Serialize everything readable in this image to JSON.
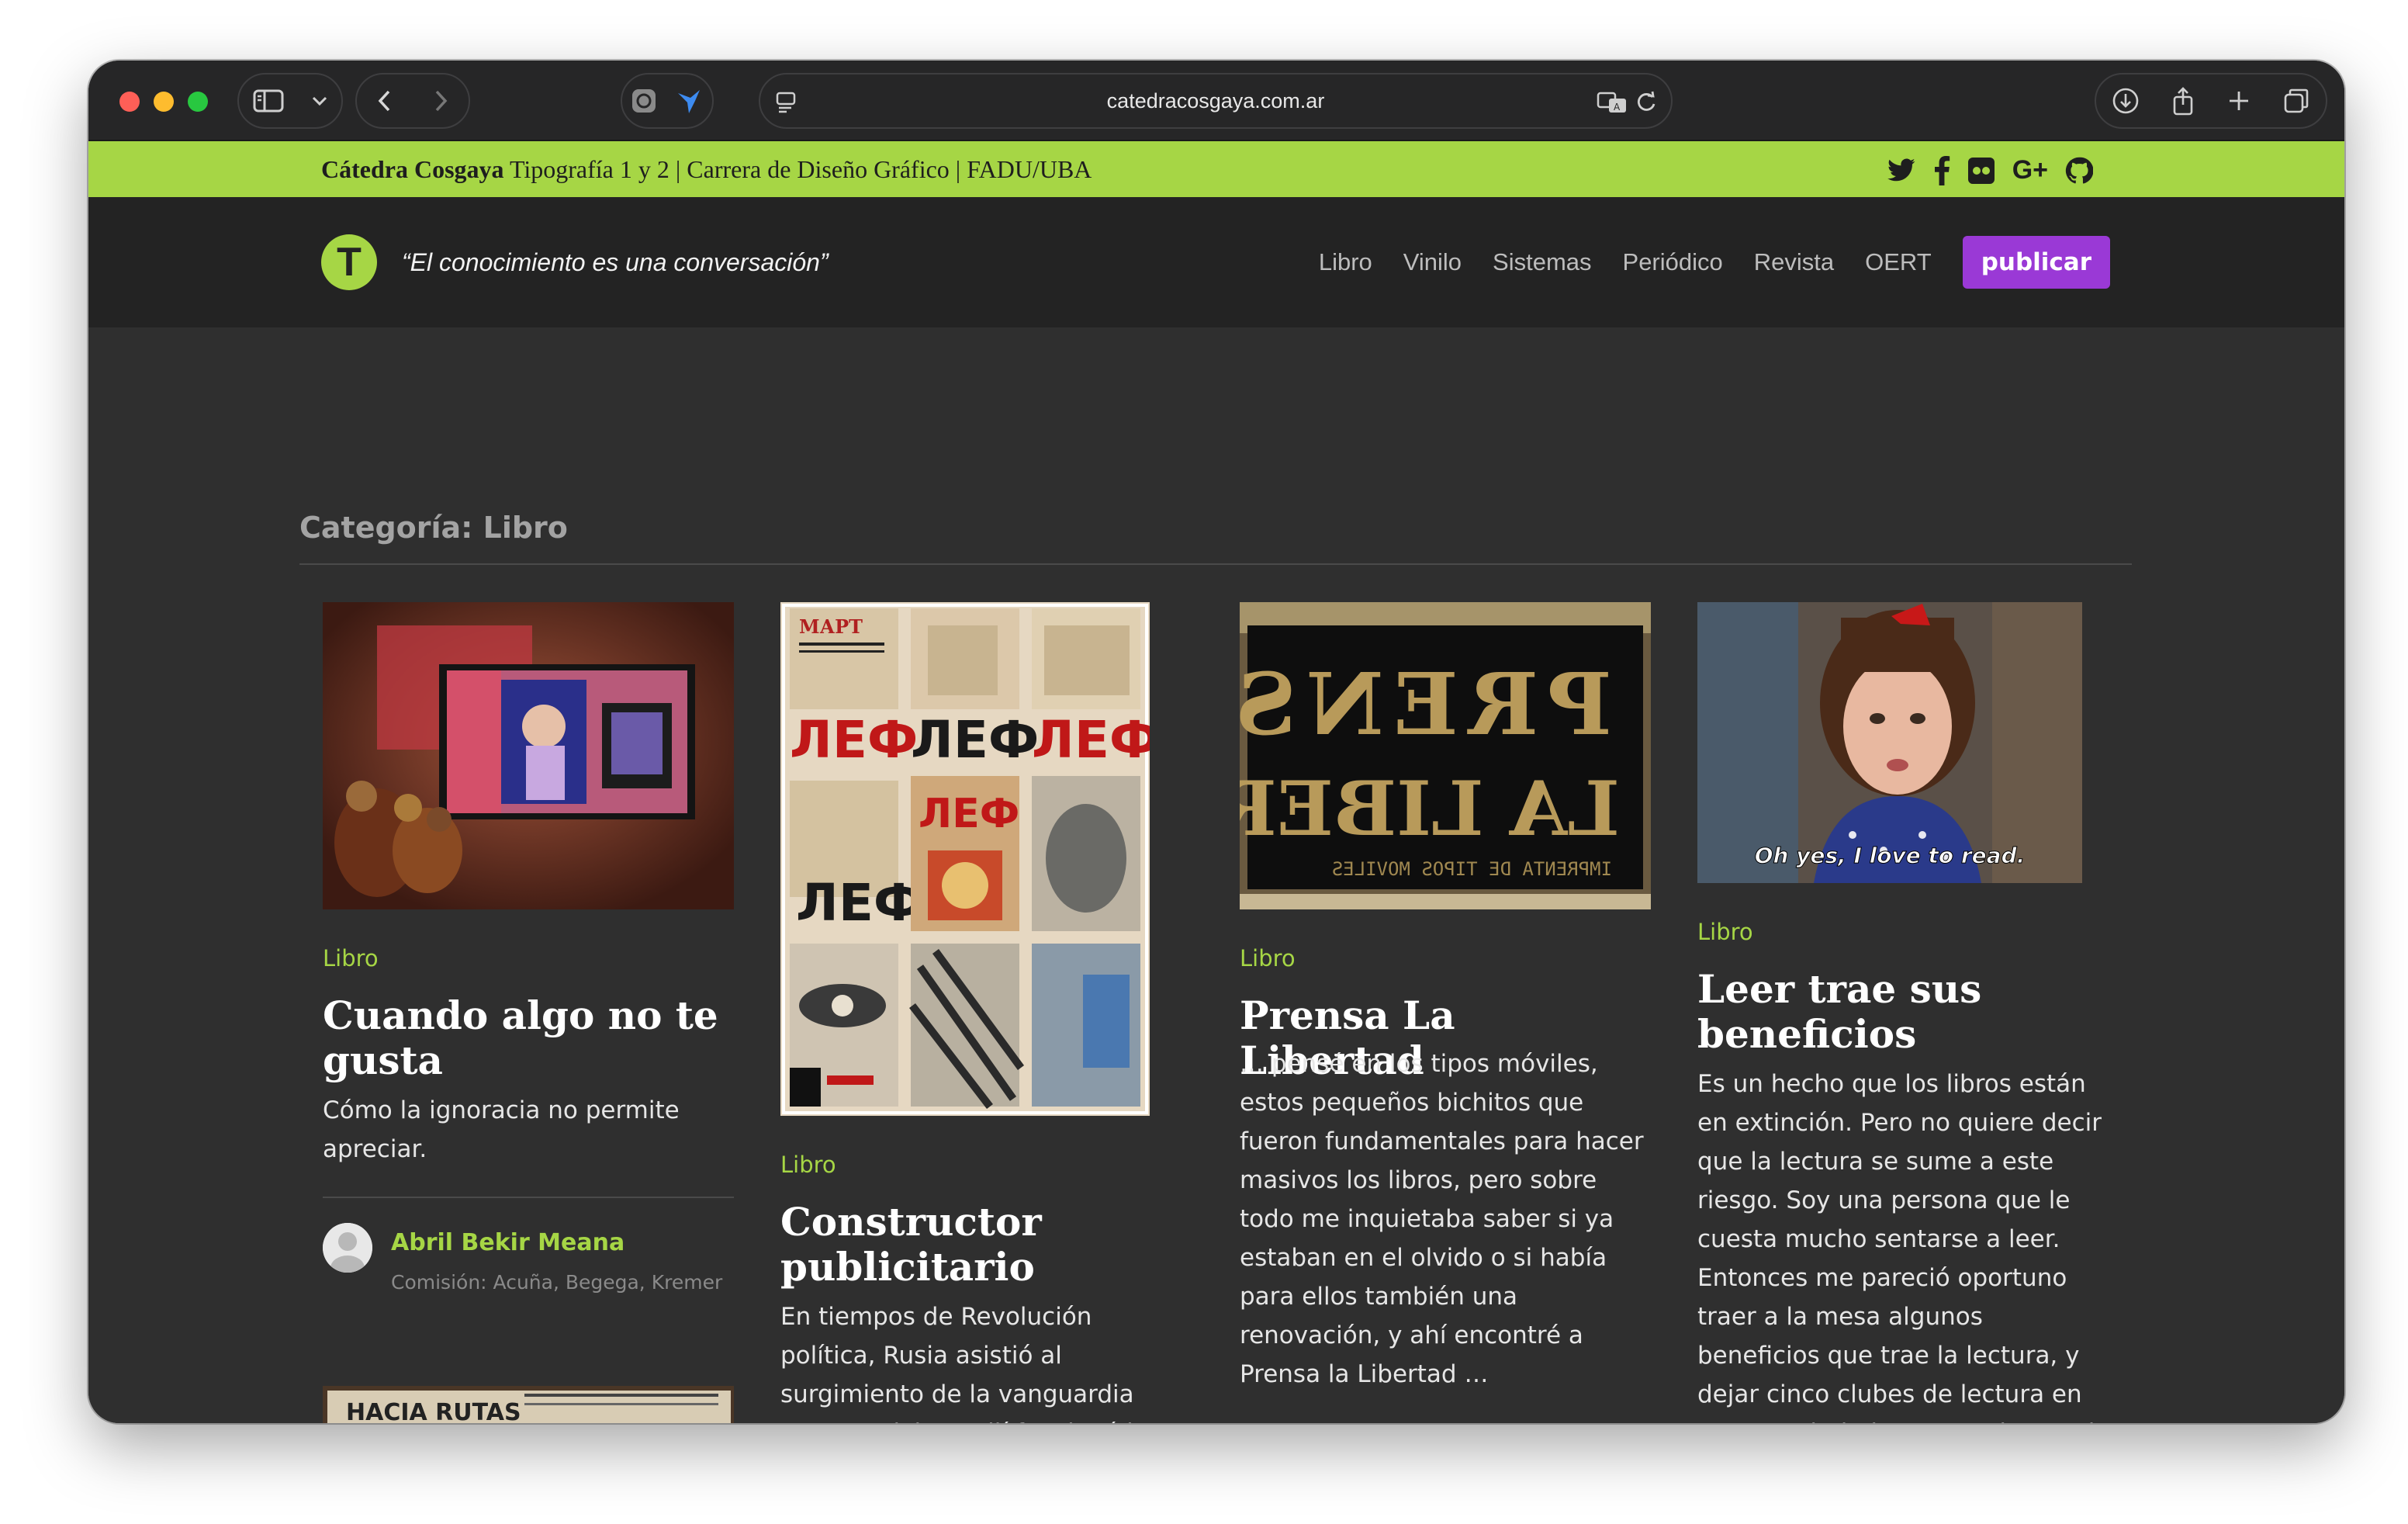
{
  "browser": {
    "url": "catedracosgaya.com.ar"
  },
  "topbar": {
    "brand": "Cátedra Cosgaya",
    "subtitle": " Tipografía 1 y 2 | Carrera de Diseño Gráfico | FADU/UBA",
    "social_icons": [
      "twitter-icon",
      "facebook-icon",
      "flickr-icon",
      "google-plus-icon",
      "github-icon"
    ],
    "google_plus_label": "G+"
  },
  "header": {
    "logo_letter": "T",
    "tagline": "“El conocimiento es una conversación”",
    "nav": [
      "Libro",
      "Vinilo",
      "Sistemas",
      "Periódico",
      "Revista",
      "OERT"
    ],
    "publish_label": "publicar"
  },
  "page": {
    "category_title": "Categoría: Libro"
  },
  "posts": [
    {
      "category": "Libro",
      "title": "Cuando algo no te gusta",
      "excerpt": "Cómo la ignoracia no permite apreciar.",
      "author": "Abril Bekir Meana",
      "meta": "Comisión: Acuña, Begega, Kremer"
    },
    {
      "category": "Libro",
      "title": "Constructor publicitario",
      "excerpt": "En tiempos de Revolución política, Rusia asistió al surgimiento de la vanguardia constructivista, allí funcionó la primera usina visual:"
    },
    {
      "category": "Libro",
      "title": "Prensa La Libertad",
      "excerpt": "… pensé en los tipos móviles, estos pequeños bichitos que fueron fundamentales para hacer masivos los libros, pero sobre todo me inquietaba saber si ya estaban en el olvido o si había para ellos también una renovación, y ahí encontré a Prensa la Libertad …"
    },
    {
      "category": "Libro",
      "title": "Leer trae sus beneficios",
      "excerpt": "Es un hecho que los libros están en extinción. Pero no quiere decir que la lectura se sume a este riesgo. Soy una persona que le cuesta mucho sentarse a leer. Entonces me pareció oportuno traer a la mesa algunos beneficios que trae la lectura, y dejar cinco clubes de lectura en nuestra ciudad, que puede ser el inicio de"
    }
  ],
  "images": {
    "lef_letters": "ЛЕФ",
    "prensa_line1": "PRENSA",
    "prensa_line2": "LA LIBERTAD",
    "prensa_line3": "IMPRENTA DE TIPOS MOVILES",
    "matilda_caption": "Oh yes, I love to read.",
    "partial_card_text": "HACIA RUTAS"
  },
  "colors": {
    "accent_green": "#a6d645",
    "publish_purple": "#9a39d6",
    "header_bg": "#232323",
    "content_bg": "#2f2f2f"
  }
}
